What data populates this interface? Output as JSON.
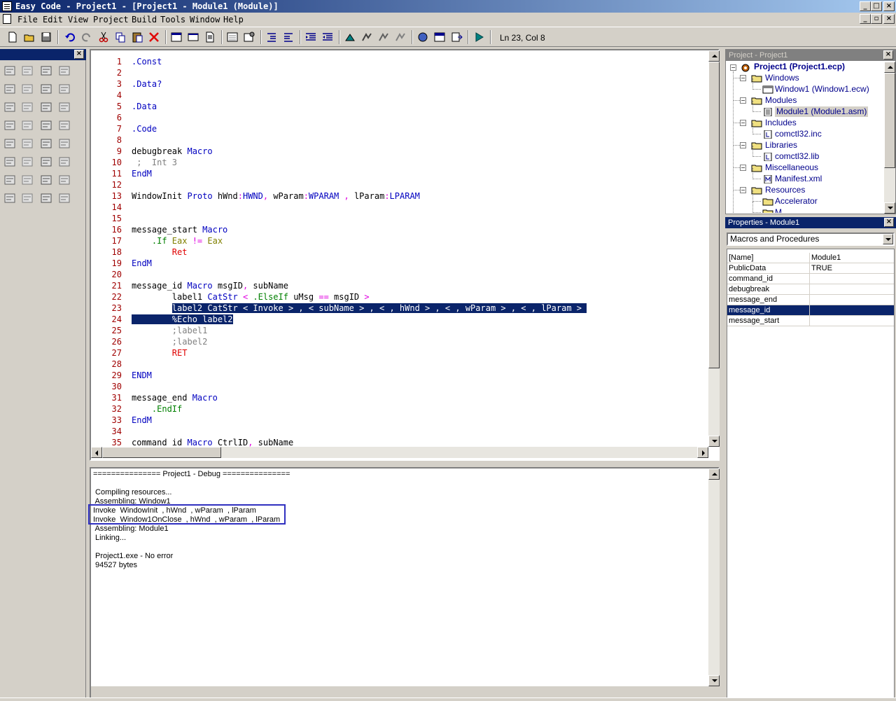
{
  "window": {
    "title": "Easy Code - Project1 - [Project1 - Module1 (Module)]",
    "caption_buttons": {
      "minimize": "_",
      "maximize": "□",
      "close": "×"
    }
  },
  "menu": {
    "items": [
      "File",
      "Edit",
      "View",
      "Project",
      "Build",
      "Tools",
      "Window",
      "Help"
    ]
  },
  "toolbar": {
    "buttons": [
      "new-file-icon",
      "open-folder-icon",
      "save-icon",
      "undo-icon",
      "redo-icon",
      "cut-icon",
      "copy-icon",
      "paste-icon",
      "delete-icon",
      "window-icon",
      "dialog-icon",
      "module-icon",
      "properties-icon",
      "settings-icon",
      "indent-icon",
      "outdent-icon",
      "comment-icon",
      "uncomment-icon",
      "compile-icon",
      "build-icon",
      "rebuild-icon",
      "assemble-icon",
      "link-icon",
      "run-icon"
    ],
    "position_label": "Ln 23, Col 8"
  },
  "palette": {
    "tools": [
      "pointer-icon",
      "label-icon",
      "textbox-icon",
      "group-icon",
      "button-icon",
      "checkbox-icon",
      "radio-icon",
      "list-icon",
      "combo-icon",
      "picture-icon",
      "image-icon",
      "scroll-icon",
      "vscroll-icon",
      "tree-icon",
      "listview-icon",
      "progress-icon",
      "hscroll-icon",
      "tab-icon",
      "statusbar-icon",
      "slider-icon",
      "updown-icon",
      "animate-icon",
      "rich-icon",
      "frame-icon",
      "grid-icon",
      "calendar-icon",
      "datetime-icon",
      "ip-icon",
      "header-icon",
      "rebar-icon",
      "pager-icon",
      "splitter-icon"
    ]
  },
  "editor": {
    "lines": [
      {
        "n": "1",
        "t": [
          [
            "kw",
            ".Const"
          ]
        ]
      },
      {
        "n": "2",
        "t": []
      },
      {
        "n": "3",
        "t": [
          [
            "kw",
            ".Data?"
          ]
        ]
      },
      {
        "n": "4",
        "t": []
      },
      {
        "n": "5",
        "t": [
          [
            "kw",
            ".Data"
          ]
        ]
      },
      {
        "n": "6",
        "t": []
      },
      {
        "n": "7",
        "t": [
          [
            "kw",
            ".Code"
          ]
        ]
      },
      {
        "n": "8",
        "t": []
      },
      {
        "n": "9",
        "t": [
          [
            "",
            "debugbreak "
          ],
          [
            "kw",
            "Macro"
          ]
        ]
      },
      {
        "n": "10",
        "t": [
          [
            "cm",
            " ;  Int 3"
          ]
        ]
      },
      {
        "n": "11",
        "t": [
          [
            "kw",
            "EndM"
          ]
        ]
      },
      {
        "n": "12",
        "t": []
      },
      {
        "n": "13",
        "t": [
          [
            "",
            "WindowInit "
          ],
          [
            "kw",
            "Proto"
          ],
          [
            "",
            " hWnd"
          ],
          [
            "op",
            ":"
          ],
          [
            "kw",
            "HWND"
          ],
          [
            "op",
            ","
          ],
          [
            "",
            " wParam"
          ],
          [
            "op",
            ":"
          ],
          [
            "kw",
            "WPARAM"
          ],
          [
            "op",
            " ,"
          ],
          [
            "",
            " lParam"
          ],
          [
            "op",
            ":"
          ],
          [
            "kw",
            "LPARAM"
          ]
        ]
      },
      {
        "n": "14",
        "t": []
      },
      {
        "n": "15",
        "t": []
      },
      {
        "n": "16",
        "t": [
          [
            "",
            "message_start "
          ],
          [
            "kw",
            "Macro"
          ]
        ]
      },
      {
        "n": "17",
        "t": [
          [
            "grn",
            "    .If"
          ],
          [
            "olv",
            " Eax"
          ],
          [
            "op",
            " !="
          ],
          [
            "olv",
            " Eax"
          ]
        ]
      },
      {
        "n": "18",
        "t": [
          [
            "red",
            "        Ret"
          ]
        ]
      },
      {
        "n": "19",
        "t": [
          [
            "kw",
            "EndM"
          ]
        ]
      },
      {
        "n": "20",
        "t": []
      },
      {
        "n": "21",
        "t": [
          [
            "",
            "message_id "
          ],
          [
            "kw",
            "Macro"
          ],
          [
            "",
            " msgID"
          ],
          [
            "op",
            ","
          ],
          [
            "",
            " subName"
          ]
        ]
      },
      {
        "n": "22",
        "t": [
          [
            "",
            "        label1 "
          ],
          [
            "kw",
            "CatStr"
          ],
          [
            "op",
            " <"
          ],
          [
            "grn",
            " .ElseIf"
          ],
          [
            "",
            " uMsg "
          ],
          [
            "op",
            "=="
          ],
          [
            "",
            " msgID "
          ],
          [
            "op",
            ">"
          ]
        ]
      },
      {
        "n": "23",
        "t": [
          [
            "",
            "        "
          ],
          [
            "sel",
            "label2 CatStr < Invoke > , < subName > , < , hWnd > , < , wParam > , < , lParam > "
          ]
        ]
      },
      {
        "n": "24",
        "t": [
          [
            "sel",
            "        %Echo label2"
          ]
        ]
      },
      {
        "n": "25",
        "t": [
          [
            "cm",
            "        ;label1"
          ]
        ]
      },
      {
        "n": "26",
        "t": [
          [
            "cm",
            "        ;label2"
          ]
        ]
      },
      {
        "n": "27",
        "t": [
          [
            "red",
            "        RET"
          ]
        ]
      },
      {
        "n": "28",
        "t": []
      },
      {
        "n": "29",
        "t": [
          [
            "kw",
            "ENDM"
          ]
        ]
      },
      {
        "n": "30",
        "t": []
      },
      {
        "n": "31",
        "t": [
          [
            "",
            "message_end "
          ],
          [
            "kw",
            "Macro"
          ]
        ]
      },
      {
        "n": "32",
        "t": [
          [
            "grn",
            "    .EndIf"
          ]
        ]
      },
      {
        "n": "33",
        "t": [
          [
            "kw",
            "EndM"
          ]
        ]
      },
      {
        "n": "34",
        "t": []
      },
      {
        "n": "35",
        "t": [
          [
            "",
            "command_id "
          ],
          [
            "kw",
            "Macro"
          ],
          [
            "",
            " CtrlID"
          ],
          [
            "op",
            ","
          ],
          [
            "",
            " subName"
          ]
        ]
      }
    ]
  },
  "output": {
    "lines": [
      "=============== Project1 - Debug ===============",
      "",
      " Compiling resources...",
      " Assembling: Window1",
      "Invoke  WindowInit  , hWnd  , wParam  , lParam",
      "Invoke  Window1OnClose  , hWnd  , wParam  , lParam",
      " Assembling: Module1",
      " Linking...",
      "",
      " Project1.exe - No error",
      " 94527 bytes"
    ]
  },
  "project": {
    "title": "Project - Project1",
    "root": "Project1 (Project1.ecp)",
    "nodes": [
      {
        "label": "Windows",
        "kind": "folder",
        "level": 1
      },
      {
        "label": "Window1 (Window1.ecw)",
        "kind": "window",
        "level": 2
      },
      {
        "label": "Modules",
        "kind": "folder",
        "level": 1
      },
      {
        "label": "Module1 (Module1.asm)",
        "kind": "module",
        "level": 2,
        "selected": true
      },
      {
        "label": "Includes",
        "kind": "folder",
        "level": 1
      },
      {
        "label": "comctl32.inc",
        "kind": "file",
        "level": 2
      },
      {
        "label": "Libraries",
        "kind": "folder",
        "level": 1
      },
      {
        "label": "comctl32.lib",
        "kind": "file",
        "level": 2
      },
      {
        "label": "Miscellaneous",
        "kind": "folder",
        "level": 1
      },
      {
        "label": "Manifest.xml",
        "kind": "manifest",
        "level": 2
      },
      {
        "label": "Resources",
        "kind": "folder",
        "level": 1
      },
      {
        "label": "Accelerator",
        "kind": "folder",
        "level": 2
      },
      {
        "label": "M...",
        "kind": "folder",
        "level": 2
      }
    ]
  },
  "properties": {
    "title": "Properties - Module1",
    "combo_value": "Macros and Procedures",
    "rows": [
      {
        "name": "[Name]",
        "value": "Module1"
      },
      {
        "name": "PublicData",
        "value": "TRUE"
      },
      {
        "name": "command_id",
        "value": ""
      },
      {
        "name": "debugbreak",
        "value": ""
      },
      {
        "name": "message_end",
        "value": ""
      },
      {
        "name": "message_id",
        "value": "",
        "selected": true
      },
      {
        "name": "message_start",
        "value": ""
      }
    ]
  },
  "colors": {
    "keyword": "#0000c0",
    "operator": "#e000e0",
    "comment": "#808080",
    "selection": "#0a246a"
  }
}
